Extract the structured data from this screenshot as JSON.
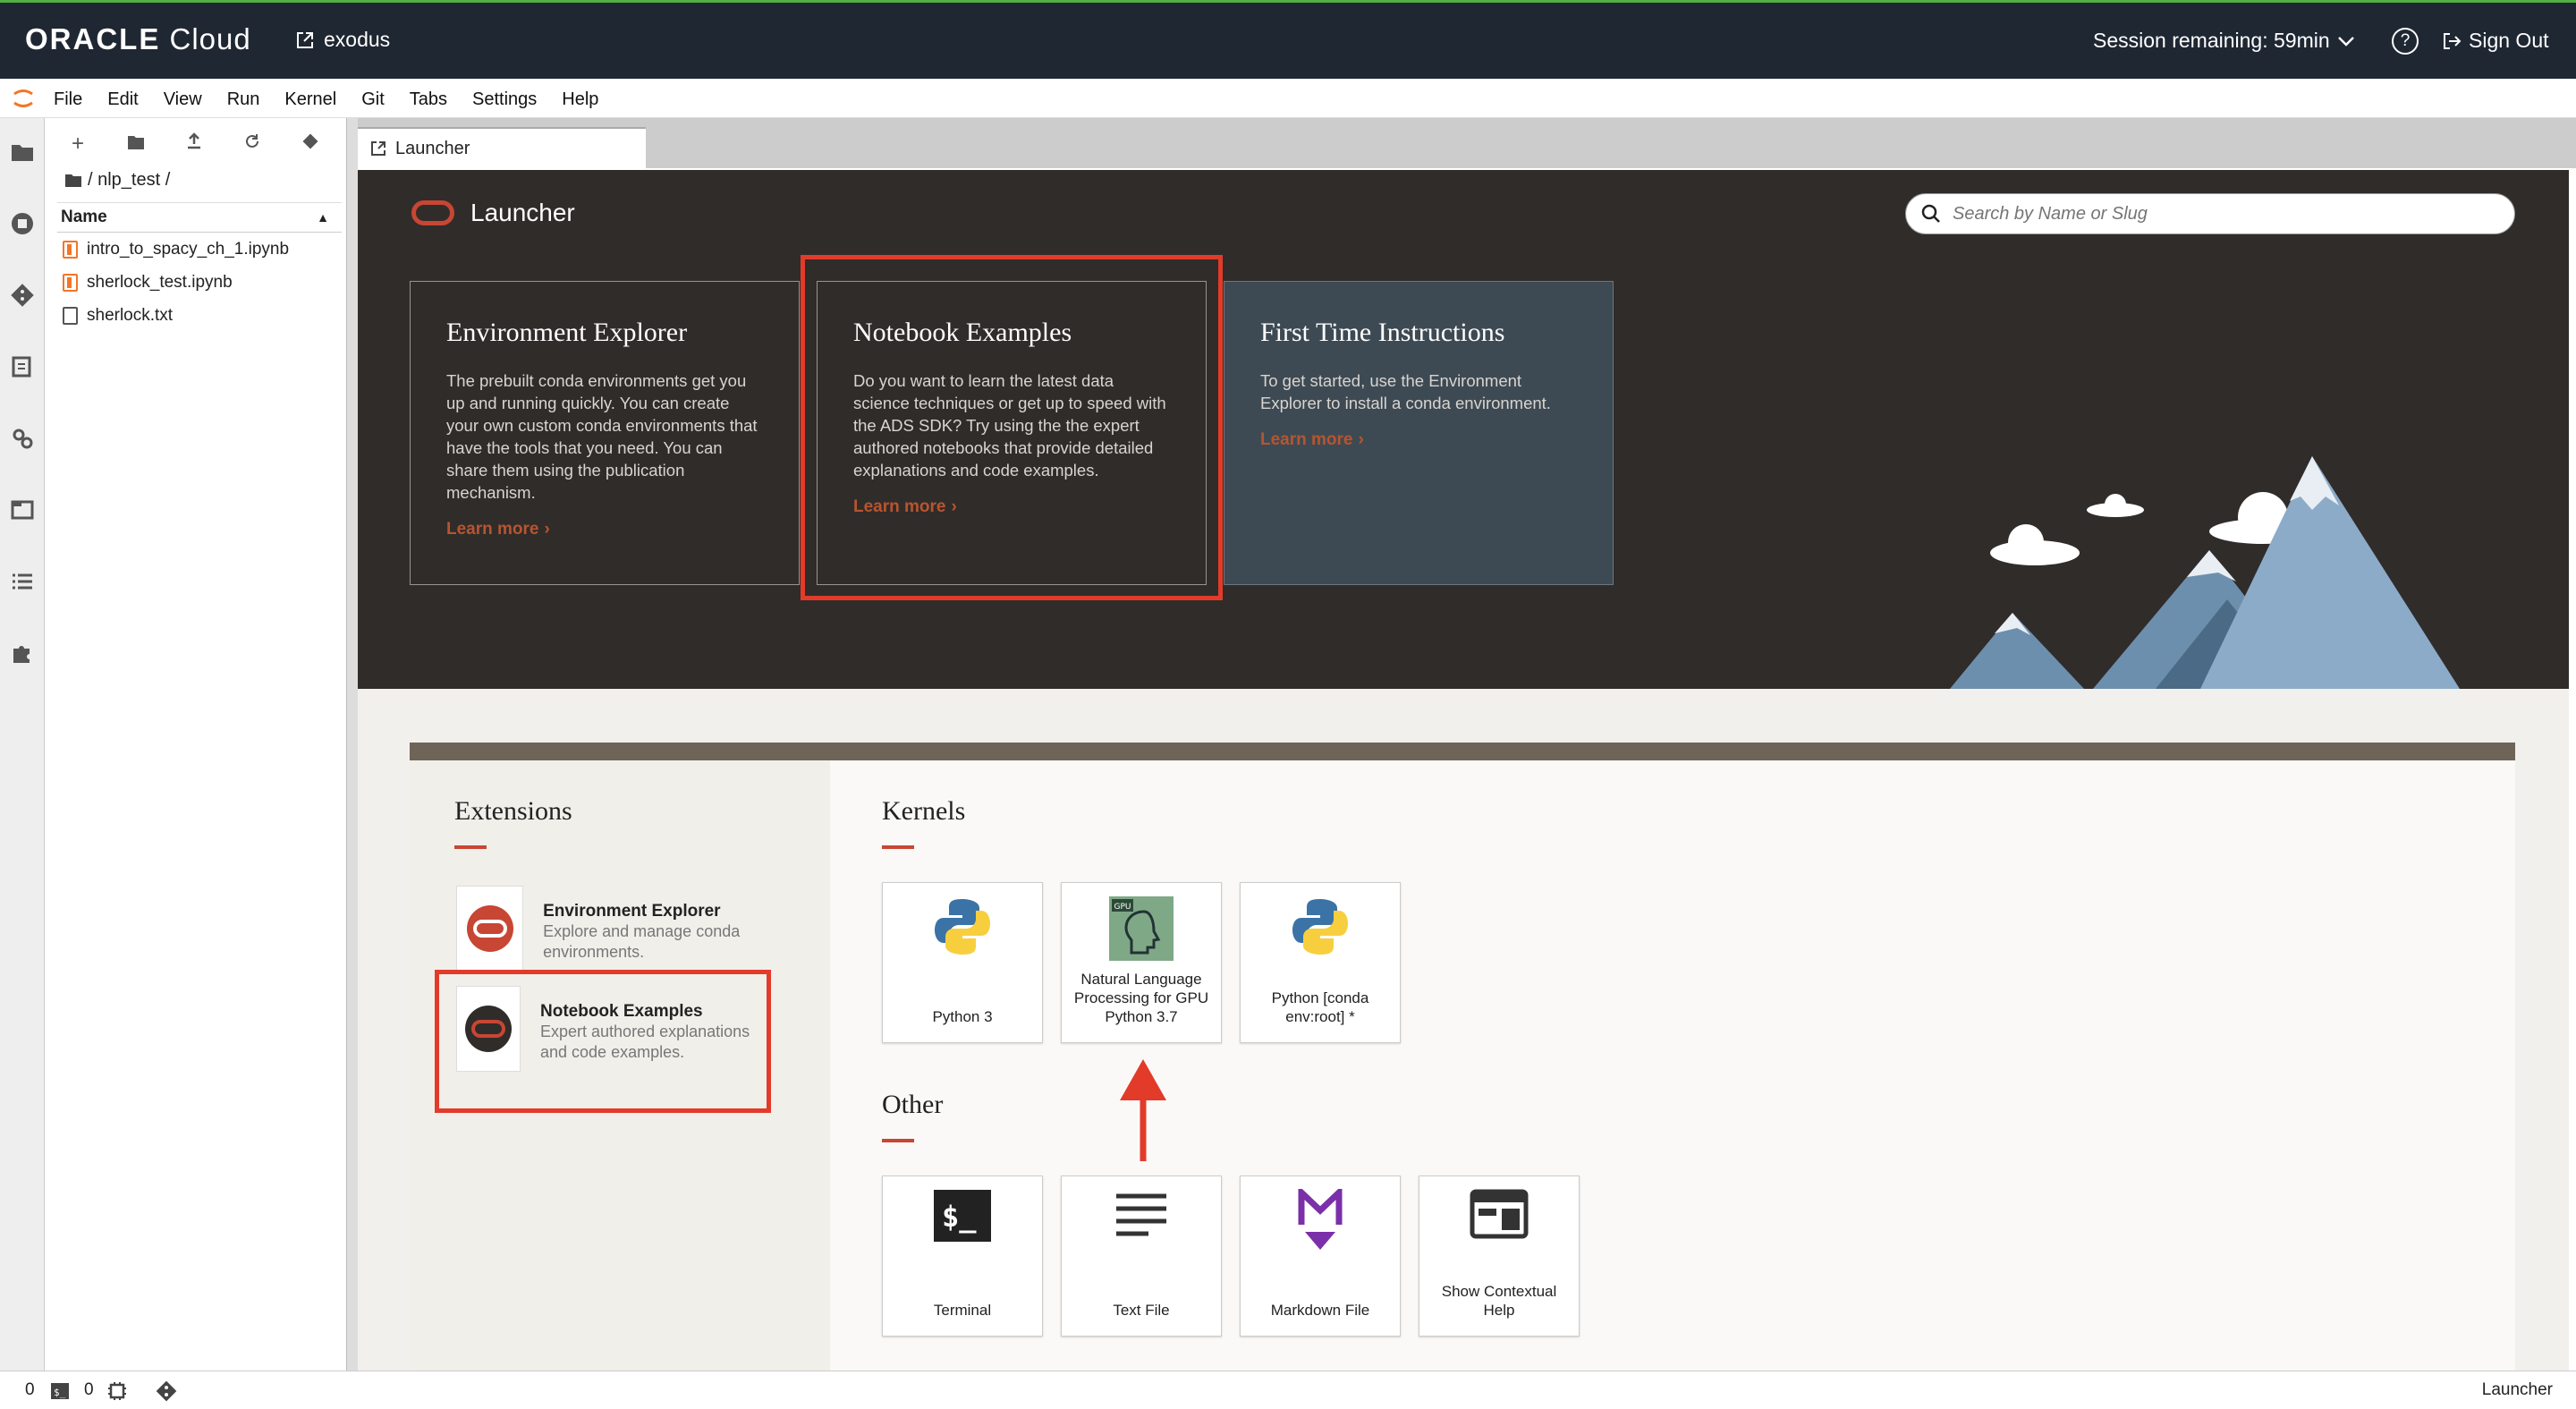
{
  "topbar": {
    "logo_brand": "ORACLE",
    "logo_product": "Cloud",
    "project": "exodus",
    "session": "Session remaining: 59min",
    "signout": "Sign Out"
  },
  "menu": [
    "File",
    "Edit",
    "View",
    "Run",
    "Kernel",
    "Git",
    "Tabs",
    "Settings",
    "Help"
  ],
  "filebrowser": {
    "path": "/ nlp_test /",
    "column": "Name",
    "files": [
      {
        "name": "intro_to_spacy_ch_1.ipynb",
        "type": "notebook"
      },
      {
        "name": "sherlock_test.ipynb",
        "type": "notebook"
      },
      {
        "name": "sherlock.txt",
        "type": "text"
      }
    ]
  },
  "tab": {
    "label": "Launcher"
  },
  "launcher": {
    "title": "Launcher",
    "search_placeholder": "Search by Name or Slug",
    "cards": [
      {
        "title": "Environment Explorer",
        "body": "The prebuilt conda environments get you up and running quickly. You can create your own custom conda environments that have the tools that you need. You can share them using the publication mechanism.",
        "link": "Learn more"
      },
      {
        "title": "Notebook Examples",
        "body": "Do you want to learn the latest data science techniques or get up to speed with the ADS SDK? Try using the the expert authored notebooks that provide detailed explanations and code examples.",
        "link": "Learn more"
      },
      {
        "title": "First Time Instructions",
        "body": "To get started, use the Environment Explorer to install a conda environment.",
        "link": "Learn more"
      }
    ],
    "extensions_title": "Extensions",
    "extensions": [
      {
        "title": "Environment Explorer",
        "desc": "Explore and manage conda environments."
      },
      {
        "title": "Notebook Examples",
        "desc": "Expert authored explanations and code examples."
      }
    ],
    "kernels_title": "Kernels",
    "kernels": [
      "Python 3",
      "Natural Language Processing for GPU Python 3.7",
      "Python [conda env:root] *"
    ],
    "gpu_badge": "GPU",
    "other_title": "Other",
    "other": [
      "Terminal",
      "Text File",
      "Markdown File",
      "Show Contextual Help"
    ]
  },
  "statusbar": {
    "left1": "0",
    "left2": "0",
    "right": "Launcher"
  },
  "colors": {
    "accent": "#c74634",
    "highlight": "#e23b2a",
    "topbar": "#1f2733",
    "hero": "#302c2a"
  }
}
